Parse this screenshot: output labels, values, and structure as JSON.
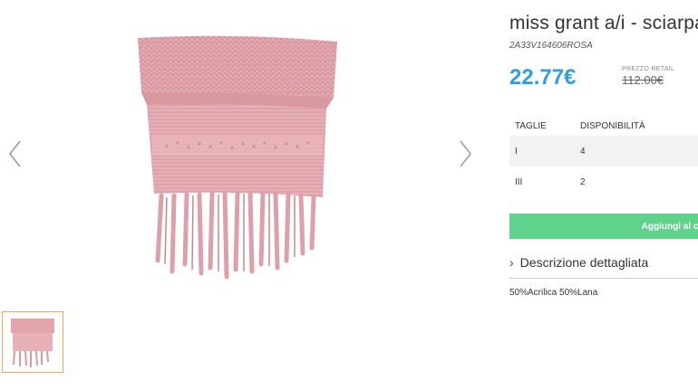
{
  "product": {
    "title": "miss grant a/i - sciarpa",
    "sku": "2A33V164606ROSA",
    "price": "22.77€",
    "retail_label": "PREZZO RETAIL",
    "retail_price": "112.00€",
    "main_color": "#e2a5ad"
  },
  "sizes": {
    "header_size": "TAGLIE",
    "header_availability": "DISPONIBILITÀ",
    "rows": [
      {
        "size": "I",
        "availability": "4"
      },
      {
        "size": "III",
        "availability": "2"
      }
    ]
  },
  "actions": {
    "add_to_cart": "Aggiungi al ca"
  },
  "details": {
    "toggle_label": "Descrizione dettagliata",
    "composition": "50%Acrilica 50%Lana"
  },
  "icons": {
    "prev": "chevron-left-icon",
    "next": "chevron-right-icon",
    "expand": "chevron-right-small-icon"
  },
  "colors": {
    "price": "#2b9fe0",
    "cart_button": "#5fd38c",
    "thumb_border": "#f0a860"
  }
}
